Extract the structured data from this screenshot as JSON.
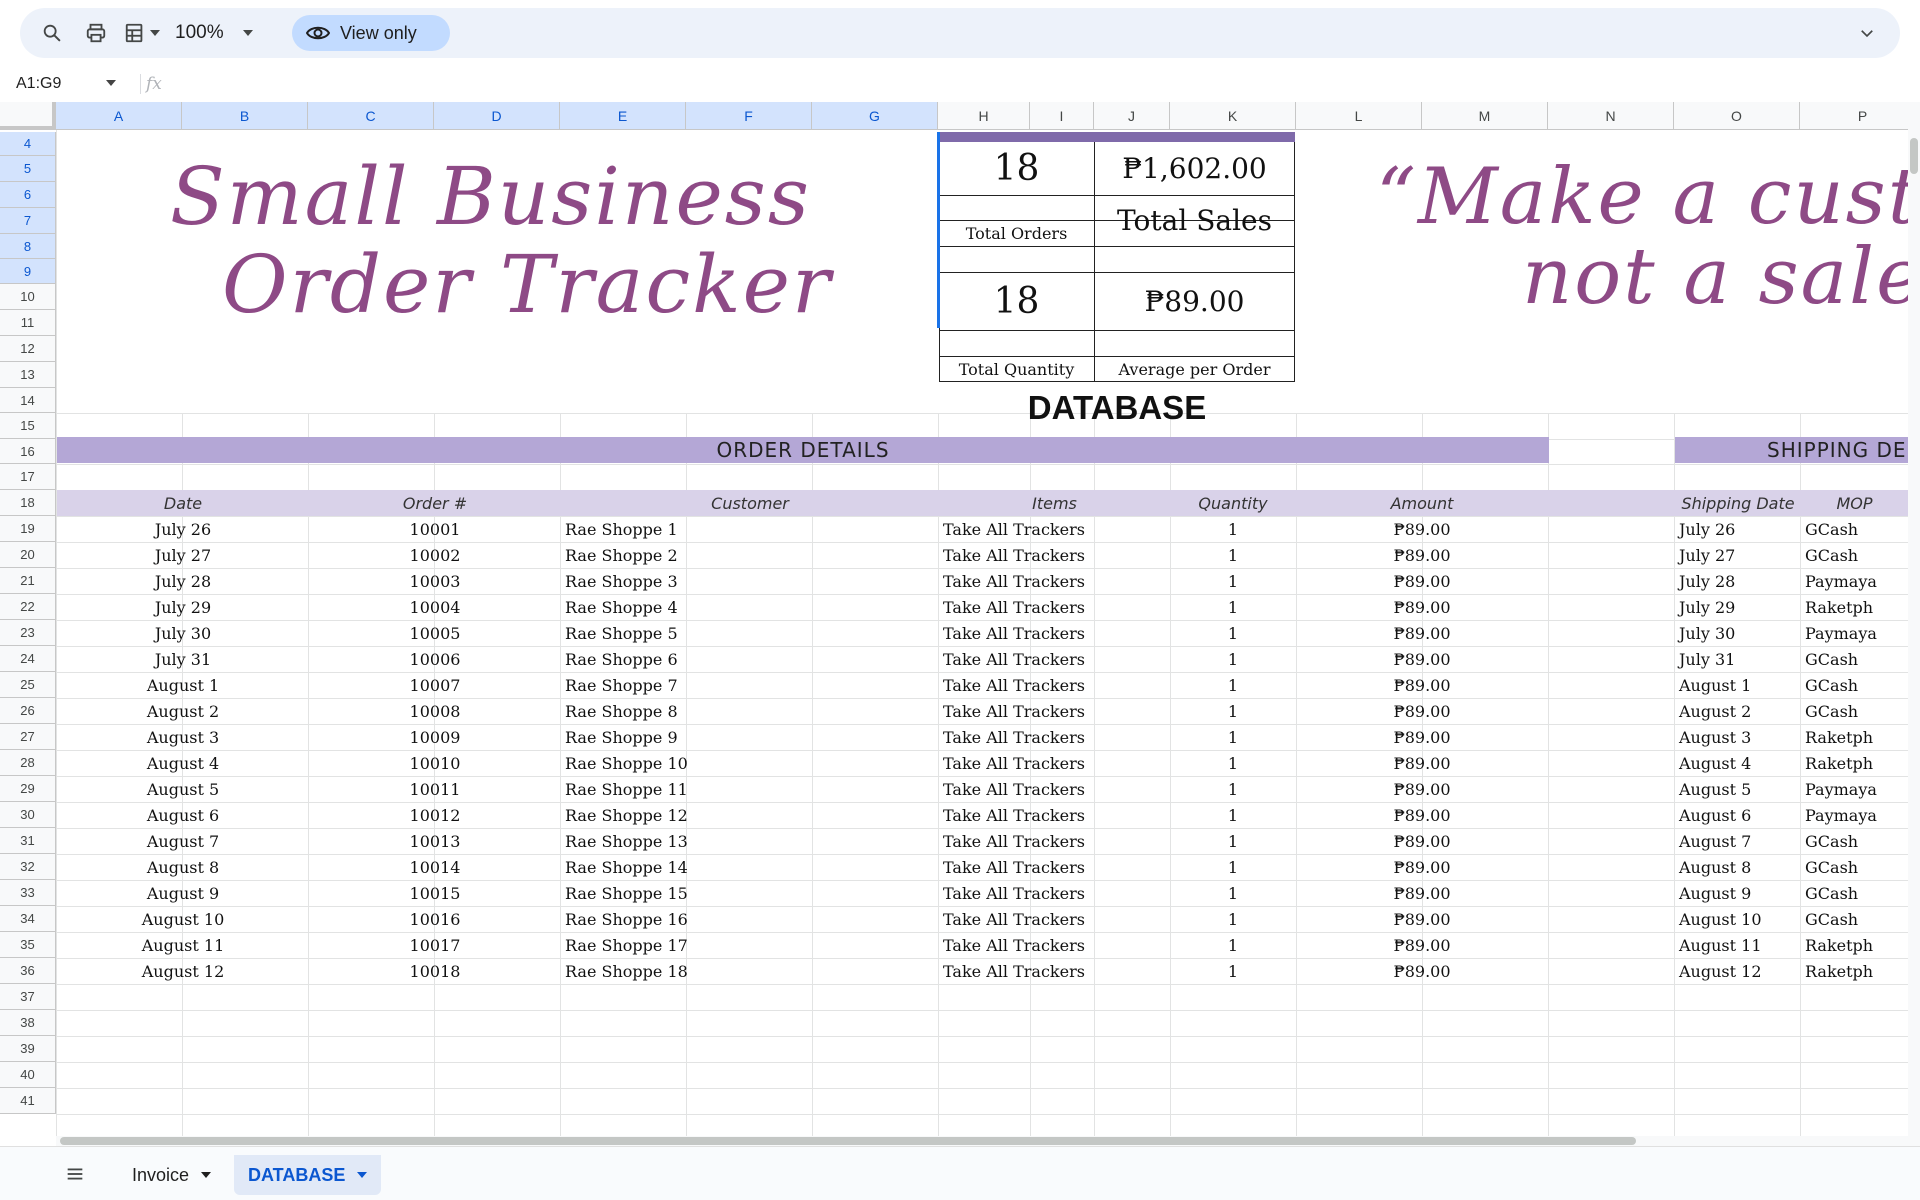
{
  "toolbar": {
    "zoom": "100%",
    "view_only_label": "View only"
  },
  "formula_bar": {
    "name_box": "A1:G9",
    "fx_label": "fx",
    "content": ""
  },
  "columns": [
    "A",
    "B",
    "C",
    "D",
    "E",
    "F",
    "G",
    "H",
    "I",
    "J",
    "K",
    "L",
    "M",
    "N",
    "O",
    "P"
  ],
  "rows": [
    "4",
    "5",
    "6",
    "7",
    "8",
    "9",
    "10",
    "11",
    "12",
    "13",
    "14",
    "15",
    "16",
    "17",
    "18",
    "19",
    "20",
    "21",
    "22",
    "23",
    "24",
    "25",
    "26",
    "27",
    "28",
    "29",
    "30",
    "31",
    "32",
    "33",
    "34",
    "35",
    "36",
    "37",
    "38",
    "39",
    "40",
    "41"
  ],
  "title": {
    "line1": "Small Business",
    "line2": "Order Tracker"
  },
  "quote": {
    "line1": "“Make a custo",
    "line2": "not a sale."
  },
  "summary": {
    "total_orders_value": "18",
    "total_orders_label": "Total Orders",
    "total_sales_value": "₱1,602.00",
    "total_sales_label": "Total Sales",
    "total_quantity_value": "18",
    "total_quantity_label": "Total Quantity",
    "average_value": "₱89.00",
    "average_label": "Average per Order",
    "database_label": "DATABASE"
  },
  "table": {
    "order_details_header": "ORDER DETAILS",
    "shipping_header": "SHIPPING DE",
    "columns": {
      "date": "Date",
      "order_no": "Order #",
      "customer": "Customer",
      "items": "Items",
      "quantity": "Quantity",
      "amount": "Amount",
      "shipping_date": "Shipping Date",
      "mop": "MOP"
    },
    "rows": [
      {
        "date": "July 26",
        "order": "10001",
        "customer": "Rae Shoppe 1",
        "items": "Take All Trackers",
        "qty": "1",
        "amount": "₱89.00",
        "ship": "July 26",
        "mop": "GCash"
      },
      {
        "date": "July 27",
        "order": "10002",
        "customer": "Rae Shoppe 2",
        "items": "Take All Trackers",
        "qty": "1",
        "amount": "₱89.00",
        "ship": "July 27",
        "mop": "GCash"
      },
      {
        "date": "July 28",
        "order": "10003",
        "customer": "Rae Shoppe 3",
        "items": "Take All Trackers",
        "qty": "1",
        "amount": "₱89.00",
        "ship": "July 28",
        "mop": "Paymaya"
      },
      {
        "date": "July 29",
        "order": "10004",
        "customer": "Rae Shoppe 4",
        "items": "Take All Trackers",
        "qty": "1",
        "amount": "₱89.00",
        "ship": "July 29",
        "mop": "Raketph"
      },
      {
        "date": "July 30",
        "order": "10005",
        "customer": "Rae Shoppe 5",
        "items": "Take All Trackers",
        "qty": "1",
        "amount": "₱89.00",
        "ship": "July 30",
        "mop": "Paymaya"
      },
      {
        "date": "July 31",
        "order": "10006",
        "customer": "Rae Shoppe 6",
        "items": "Take All Trackers",
        "qty": "1",
        "amount": "₱89.00",
        "ship": "July 31",
        "mop": "GCash"
      },
      {
        "date": "August 1",
        "order": "10007",
        "customer": "Rae Shoppe 7",
        "items": "Take All Trackers",
        "qty": "1",
        "amount": "₱89.00",
        "ship": "August 1",
        "mop": "GCash"
      },
      {
        "date": "August 2",
        "order": "10008",
        "customer": "Rae Shoppe 8",
        "items": "Take All Trackers",
        "qty": "1",
        "amount": "₱89.00",
        "ship": "August 2",
        "mop": "GCash"
      },
      {
        "date": "August 3",
        "order": "10009",
        "customer": "Rae Shoppe 9",
        "items": "Take All Trackers",
        "qty": "1",
        "amount": "₱89.00",
        "ship": "August 3",
        "mop": "Raketph"
      },
      {
        "date": "August 4",
        "order": "10010",
        "customer": "Rae Shoppe 10",
        "items": "Take All Trackers",
        "qty": "1",
        "amount": "₱89.00",
        "ship": "August 4",
        "mop": "Raketph"
      },
      {
        "date": "August 5",
        "order": "10011",
        "customer": "Rae Shoppe 11",
        "items": "Take All Trackers",
        "qty": "1",
        "amount": "₱89.00",
        "ship": "August 5",
        "mop": "Paymaya"
      },
      {
        "date": "August 6",
        "order": "10012",
        "customer": "Rae Shoppe 12",
        "items": "Take All Trackers",
        "qty": "1",
        "amount": "₱89.00",
        "ship": "August 6",
        "mop": "Paymaya"
      },
      {
        "date": "August 7",
        "order": "10013",
        "customer": "Rae Shoppe 13",
        "items": "Take All Trackers",
        "qty": "1",
        "amount": "₱89.00",
        "ship": "August 7",
        "mop": "GCash"
      },
      {
        "date": "August 8",
        "order": "10014",
        "customer": "Rae Shoppe 14",
        "items": "Take All Trackers",
        "qty": "1",
        "amount": "₱89.00",
        "ship": "August 8",
        "mop": "GCash"
      },
      {
        "date": "August 9",
        "order": "10015",
        "customer": "Rae Shoppe 15",
        "items": "Take All Trackers",
        "qty": "1",
        "amount": "₱89.00",
        "ship": "August 9",
        "mop": "GCash"
      },
      {
        "date": "August 10",
        "order": "10016",
        "customer": "Rae Shoppe 16",
        "items": "Take All Trackers",
        "qty": "1",
        "amount": "₱89.00",
        "ship": "August 10",
        "mop": "GCash"
      },
      {
        "date": "August 11",
        "order": "10017",
        "customer": "Rae Shoppe 17",
        "items": "Take All Trackers",
        "qty": "1",
        "amount": "₱89.00",
        "ship": "August 11",
        "mop": "Raketph"
      },
      {
        "date": "August 12",
        "order": "10018",
        "customer": "Rae Shoppe 18",
        "items": "Take All Trackers",
        "qty": "1",
        "amount": "₱89.00",
        "ship": "August 12",
        "mop": "Raketph"
      }
    ]
  },
  "sheet_tabs": [
    {
      "label": "Invoice",
      "active": false
    },
    {
      "label": "DATABASE",
      "active": true
    }
  ],
  "colors": {
    "accent_purple": "#b4a7d6",
    "header_lilac": "#d9d2e9",
    "script_plum": "#8e4a86",
    "selection_blue": "#d3e3fd"
  }
}
